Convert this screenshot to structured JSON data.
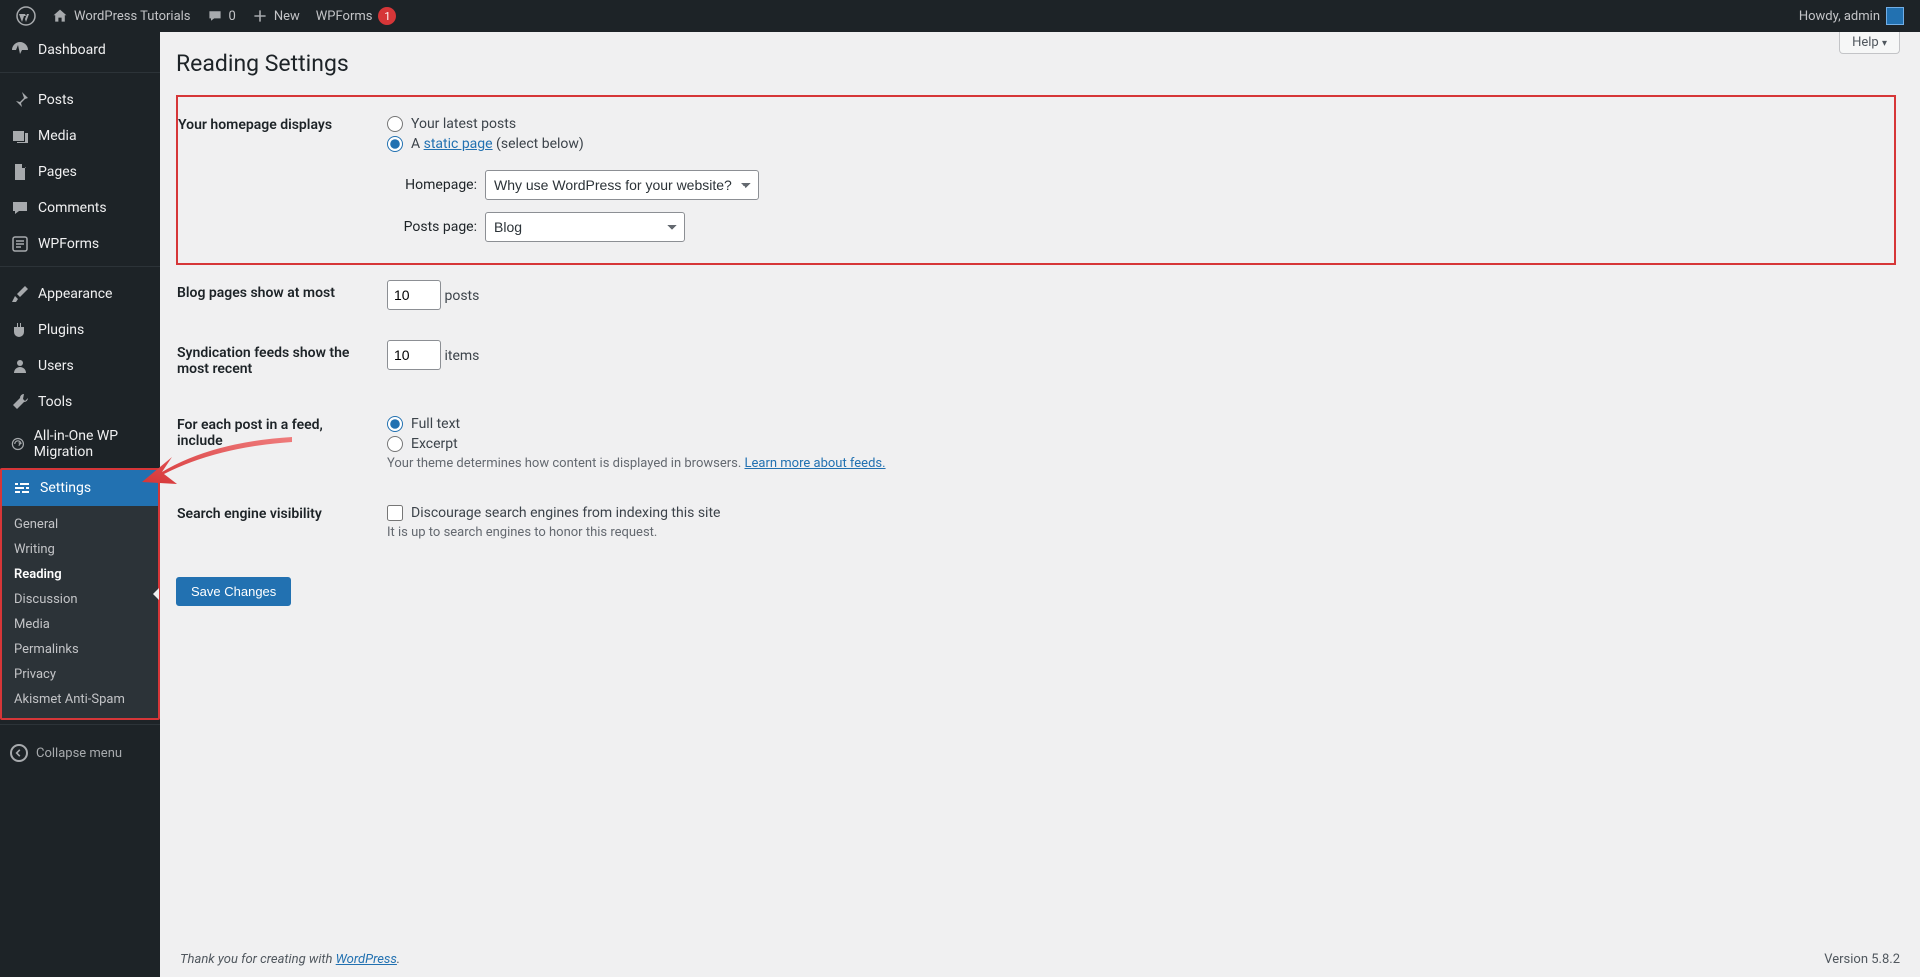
{
  "adminbar": {
    "site_name": "WordPress Tutorials",
    "comments_count": "0",
    "new_label": "New",
    "wpforms_label": "WPForms",
    "wpforms_badge": "1",
    "howdy": "Howdy, admin"
  },
  "sidebar": {
    "dashboard": "Dashboard",
    "posts": "Posts",
    "media": "Media",
    "pages": "Pages",
    "comments": "Comments",
    "wpforms": "WPForms",
    "appearance": "Appearance",
    "plugins": "Plugins",
    "users": "Users",
    "tools": "Tools",
    "aio": "All-in-One WP Migration",
    "settings": "Settings",
    "sub": {
      "general": "General",
      "writing": "Writing",
      "reading": "Reading",
      "discussion": "Discussion",
      "media": "Media",
      "permalinks": "Permalinks",
      "privacy": "Privacy",
      "akismet": "Akismet Anti-Spam"
    },
    "collapse": "Collapse menu"
  },
  "page": {
    "title": "Reading Settings",
    "help": "Help"
  },
  "homepage": {
    "th": "Your homepage displays",
    "opt_latest": "Your latest posts",
    "opt_static_prefix": "A ",
    "opt_static_link": "static page",
    "opt_static_suffix": " (select below)",
    "homepage_label": "Homepage:",
    "homepage_value": "Why use WordPress for your website?",
    "postspage_label": "Posts page:",
    "postspage_value": "Blog"
  },
  "blog_pages": {
    "th": "Blog pages show at most",
    "value": "10",
    "unit": "posts"
  },
  "feeds": {
    "th": "Syndication feeds show the most recent",
    "value": "10",
    "unit": "items"
  },
  "feed_content": {
    "th": "For each post in a feed, include",
    "full": "Full text",
    "excerpt": "Excerpt",
    "desc_prefix": "Your theme determines how content is displayed in browsers. ",
    "desc_link": "Learn more about feeds."
  },
  "seo": {
    "th": "Search engine visibility",
    "checkbox": "Discourage search engines from indexing this site",
    "desc": "It is up to search engines to honor this request."
  },
  "save": "Save Changes",
  "footer": {
    "thanks_prefix": "Thank you for creating with ",
    "thanks_link": "WordPress",
    "thanks_suffix": ".",
    "version": "Version 5.8.2"
  }
}
